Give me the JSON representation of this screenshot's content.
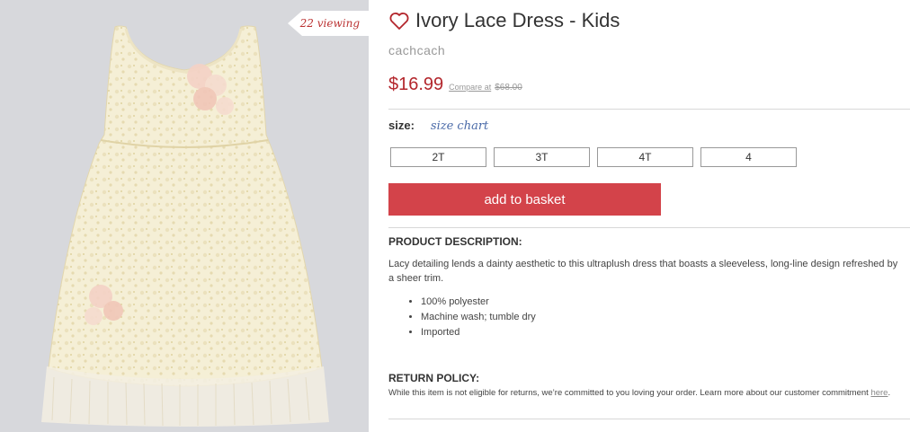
{
  "image": {
    "viewing_badge": "22 viewing",
    "alt_subject": "dress-photo"
  },
  "product": {
    "title": "Ivory Lace Dress - Kids",
    "brand": "cachcach",
    "price": "$16.99",
    "compare_label": "Compare at",
    "compare_price": "$68.00"
  },
  "size": {
    "label": "size:",
    "chart_link": "size chart",
    "options": [
      "2T",
      "3T",
      "4T",
      "4"
    ]
  },
  "cart": {
    "add_label": "add to basket"
  },
  "description": {
    "heading": "PRODUCT DESCRIPTION:",
    "text": "Lacy detailing lends a dainty aesthetic to this ultraplush dress that boasts a sleeveless, long-line design refreshed by a sheer trim.",
    "bullets": [
      "100% polyester",
      "Machine wash; tumble dry",
      "Imported"
    ]
  },
  "return_policy": {
    "heading": "RETURN POLICY:",
    "text": "While this item is not eligible for returns, we’re committed to you loving your order. Learn more about our customer commitment ",
    "link": "here",
    "suffix": "."
  },
  "colors": {
    "price_red": "#b3262c",
    "button_red": "#d3434a",
    "link_blue": "#4a6aa8",
    "image_bg": "#d7d8dc"
  },
  "icons": {
    "favorite": "heart-outline-icon"
  }
}
